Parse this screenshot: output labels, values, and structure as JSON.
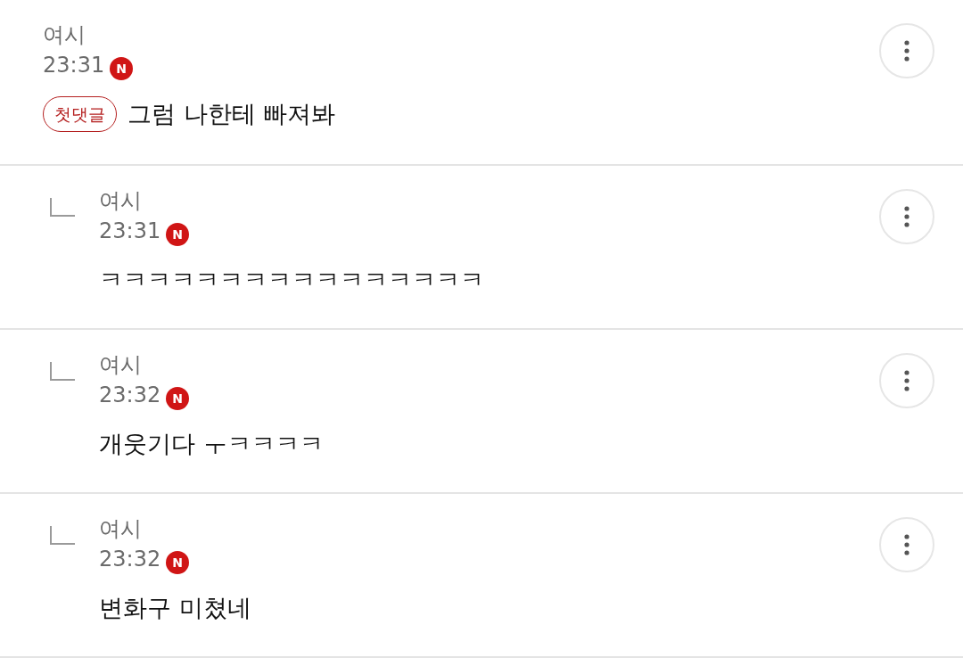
{
  "comments": [
    {
      "kind": "comment",
      "author": "여시",
      "time": "23:31",
      "badge": "N",
      "tag": "첫댓글",
      "text": "그럼 나한테 빠져봐"
    },
    {
      "kind": "reply",
      "author": "여시",
      "time": "23:31",
      "badge": "N",
      "text": "ㅋㅋㅋㅋㅋㅋㅋㅋㅋㅋㅋㅋㅋㅋㅋㅋ"
    },
    {
      "kind": "reply",
      "author": "여시",
      "time": "23:32",
      "badge": "N",
      "text": "개웃기다 ㅜㅋㅋㅋㅋ"
    },
    {
      "kind": "reply",
      "author": "여시",
      "time": "23:32",
      "badge": "N",
      "text": "변화구 미쳤네"
    }
  ]
}
